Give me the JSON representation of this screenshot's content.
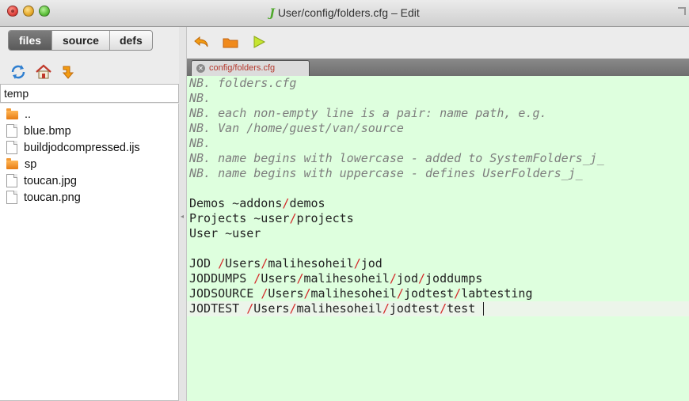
{
  "window": {
    "title": "User/config/folders.cfg – Edit",
    "title_icon": "J",
    "colors": {
      "editor_bg": "#deffde",
      "current_line": "#ecf5ea",
      "path_separator": "#d42a2a"
    }
  },
  "left": {
    "tabs": [
      {
        "label": "files",
        "active": true
      },
      {
        "label": "source",
        "active": false
      },
      {
        "label": "defs",
        "active": false
      }
    ],
    "tools": [
      "refresh-icon",
      "home-icon",
      "arrow-down-right-icon"
    ],
    "path": "temp",
    "files": [
      {
        "name": "..",
        "type": "folder"
      },
      {
        "name": "blue.bmp",
        "type": "file"
      },
      {
        "name": "buildjodcompressed.ijs",
        "type": "file"
      },
      {
        "name": "sp",
        "type": "folder"
      },
      {
        "name": "toucan.jpg",
        "type": "file"
      },
      {
        "name": "toucan.png",
        "type": "file"
      }
    ]
  },
  "toolbar": {
    "tools": [
      "undo-icon",
      "folder-icon",
      "run-icon"
    ]
  },
  "editor": {
    "tab_label": "config/folders.cfg",
    "lines": [
      {
        "parts": [
          "NB. folders.cfg"
        ],
        "comment": true
      },
      {
        "parts": [
          "NB."
        ],
        "comment": true
      },
      {
        "parts": [
          "NB. each non-empty line is a pair: name path, e.g."
        ],
        "comment": true
      },
      {
        "parts": [
          "NB. Van /home/guest/van/source"
        ],
        "comment": true
      },
      {
        "parts": [
          "NB."
        ],
        "comment": true
      },
      {
        "parts": [
          "NB. name begins with lowercase - added to SystemFolders_j_"
        ],
        "comment": true
      },
      {
        "parts": [
          "NB. name begins with uppercase - defines UserFolders_j_"
        ],
        "comment": true
      },
      {
        "parts": [
          ""
        ]
      },
      {
        "parts": [
          "Demos ~addons",
          "/",
          "demos"
        ]
      },
      {
        "parts": [
          "Projects ~user",
          "/",
          "projects"
        ]
      },
      {
        "parts": [
          "User ~user"
        ]
      },
      {
        "parts": [
          ""
        ]
      },
      {
        "parts": [
          "JOD ",
          "/",
          "Users",
          "/",
          "malihesoheil",
          "/",
          "jod"
        ]
      },
      {
        "parts": [
          "JODDUMPS ",
          "/",
          "Users",
          "/",
          "malihesoheil",
          "/",
          "jod",
          "/",
          "joddumps"
        ]
      },
      {
        "parts": [
          "JODSOURCE ",
          "/",
          "Users",
          "/",
          "malihesoheil",
          "/",
          "jodtest",
          "/",
          "labtesting"
        ]
      },
      {
        "parts": [
          "JODTEST ",
          "/",
          "Users",
          "/",
          "malihesoheil",
          "/",
          "jodtest",
          "/",
          "test "
        ],
        "current": true
      }
    ]
  }
}
